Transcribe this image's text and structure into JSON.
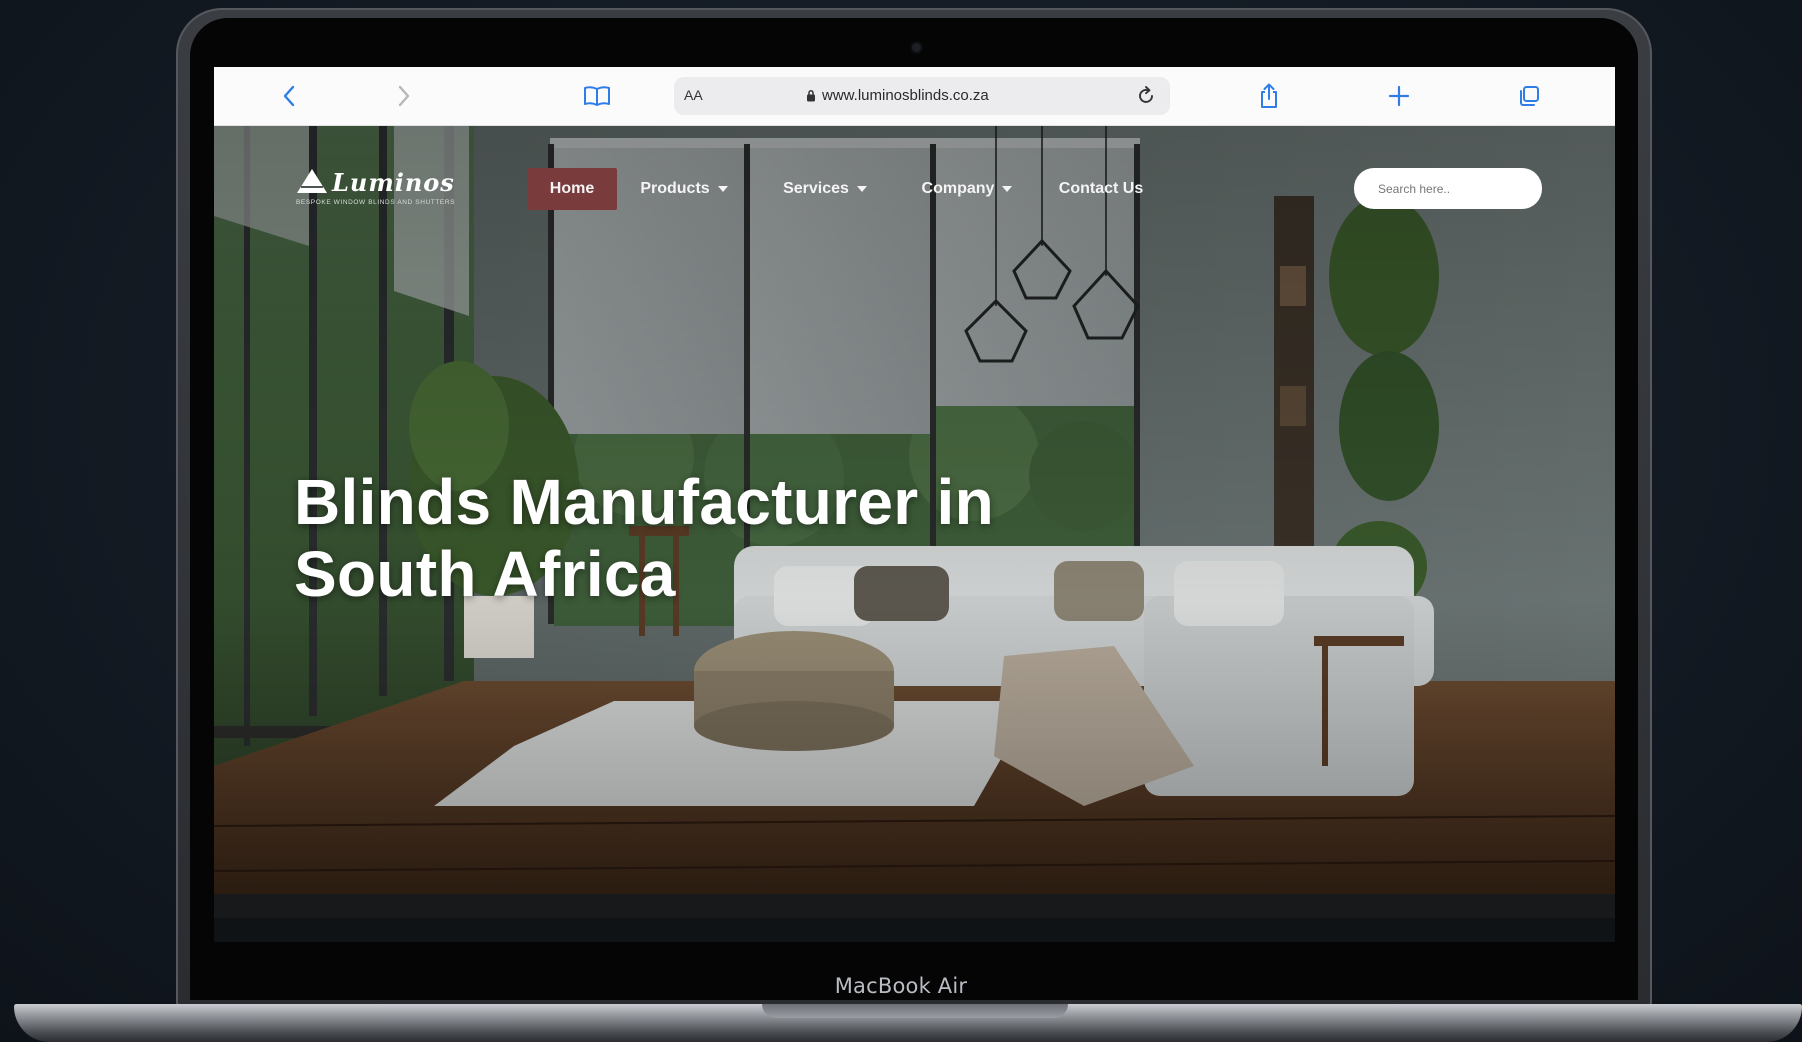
{
  "device": {
    "label": "MacBook Air"
  },
  "browser": {
    "text_size_label": "AA",
    "url": "www.luminosblinds.co.za",
    "icons": [
      "back-icon",
      "forward-icon",
      "bookmarks-icon",
      "lock-icon",
      "reload-icon",
      "share-icon",
      "new-tab-icon",
      "tabs-icon"
    ],
    "accent_color": "#2f7ee8"
  },
  "site": {
    "logo": {
      "name": "Luminos",
      "tagline": "BESPOKE WINDOW BLINDS AND SHUTTERS"
    },
    "nav": {
      "items": [
        {
          "label": "Home",
          "active": true,
          "dropdown": false
        },
        {
          "label": "Products",
          "active": false,
          "dropdown": true
        },
        {
          "label": "Services",
          "active": false,
          "dropdown": true
        },
        {
          "label": "Company",
          "active": false,
          "dropdown": true
        },
        {
          "label": "Contact Us",
          "active": false,
          "dropdown": false
        }
      ],
      "active_color": "#7a3b3d"
    },
    "search": {
      "placeholder": "Search here..",
      "value": ""
    },
    "hero": {
      "title_line1": "Blinds Manufacturer in",
      "title_line2": "South Africa"
    }
  }
}
